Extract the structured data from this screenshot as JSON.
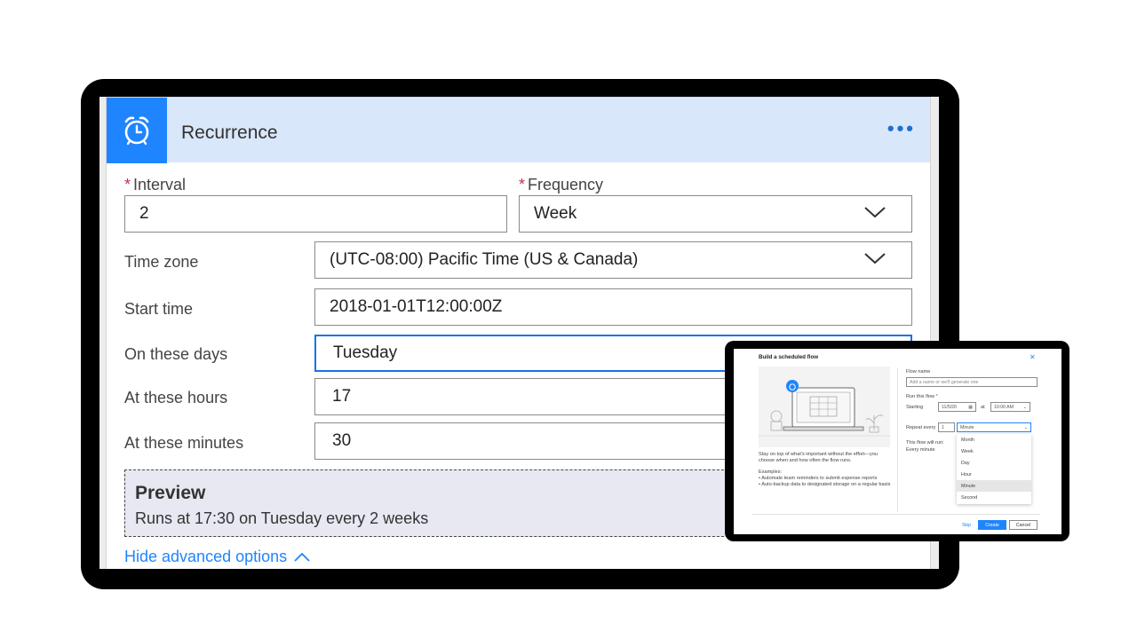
{
  "recurrence": {
    "title": "Recurrence",
    "more_label": "•••",
    "interval_label": "Interval",
    "interval_value": "2",
    "frequency_label": "Frequency",
    "frequency_value": "Week",
    "timezone_label": "Time zone",
    "timezone_value": "(UTC-08:00) Pacific Time (US & Canada)",
    "start_time_label": "Start time",
    "start_time_value": "2018-01-01T12:00:00Z",
    "days_label": "On these days",
    "days_value": "Tuesday",
    "hours_label": "At these hours",
    "hours_value": "17",
    "minutes_label": "At these minutes",
    "minutes_value": "30",
    "preview_title": "Preview",
    "preview_text": "Runs at 17:30 on Tuesday every 2 weeks",
    "hide_advanced": "Hide advanced options",
    "required_mark": "*"
  },
  "scheduled_dialog": {
    "title": "Build a scheduled flow",
    "close": "✕",
    "description": "Stay on top of what's important without the effort—you choose when and how often the flow runs.",
    "examples_label": "Examples:",
    "examples": [
      "Automate team reminders to submit expense reports",
      "Auto-backup data to designated storage on a regular basis"
    ],
    "flow_name_label": "Flow name",
    "flow_name_placeholder": "Add a name or we'll generate one",
    "run_label": "Run this flow",
    "starting_label": "Starting",
    "start_date": "11/5/20",
    "at_label": "at",
    "start_time": "10:00 AM",
    "repeat_label": "Repeat every",
    "repeat_value": "1",
    "repeat_unit": "Minute",
    "will_run_label": "This flow will run:",
    "will_run_value": "Every minute",
    "unit_options": [
      "Month",
      "Week",
      "Day",
      "Hour",
      "Minute",
      "Second"
    ],
    "skip": "Skip",
    "create": "Create",
    "cancel": "Cancel"
  },
  "colors": {
    "accent": "#1f85ff",
    "header_bg": "#d9e7fb",
    "required": "#c4314b"
  }
}
